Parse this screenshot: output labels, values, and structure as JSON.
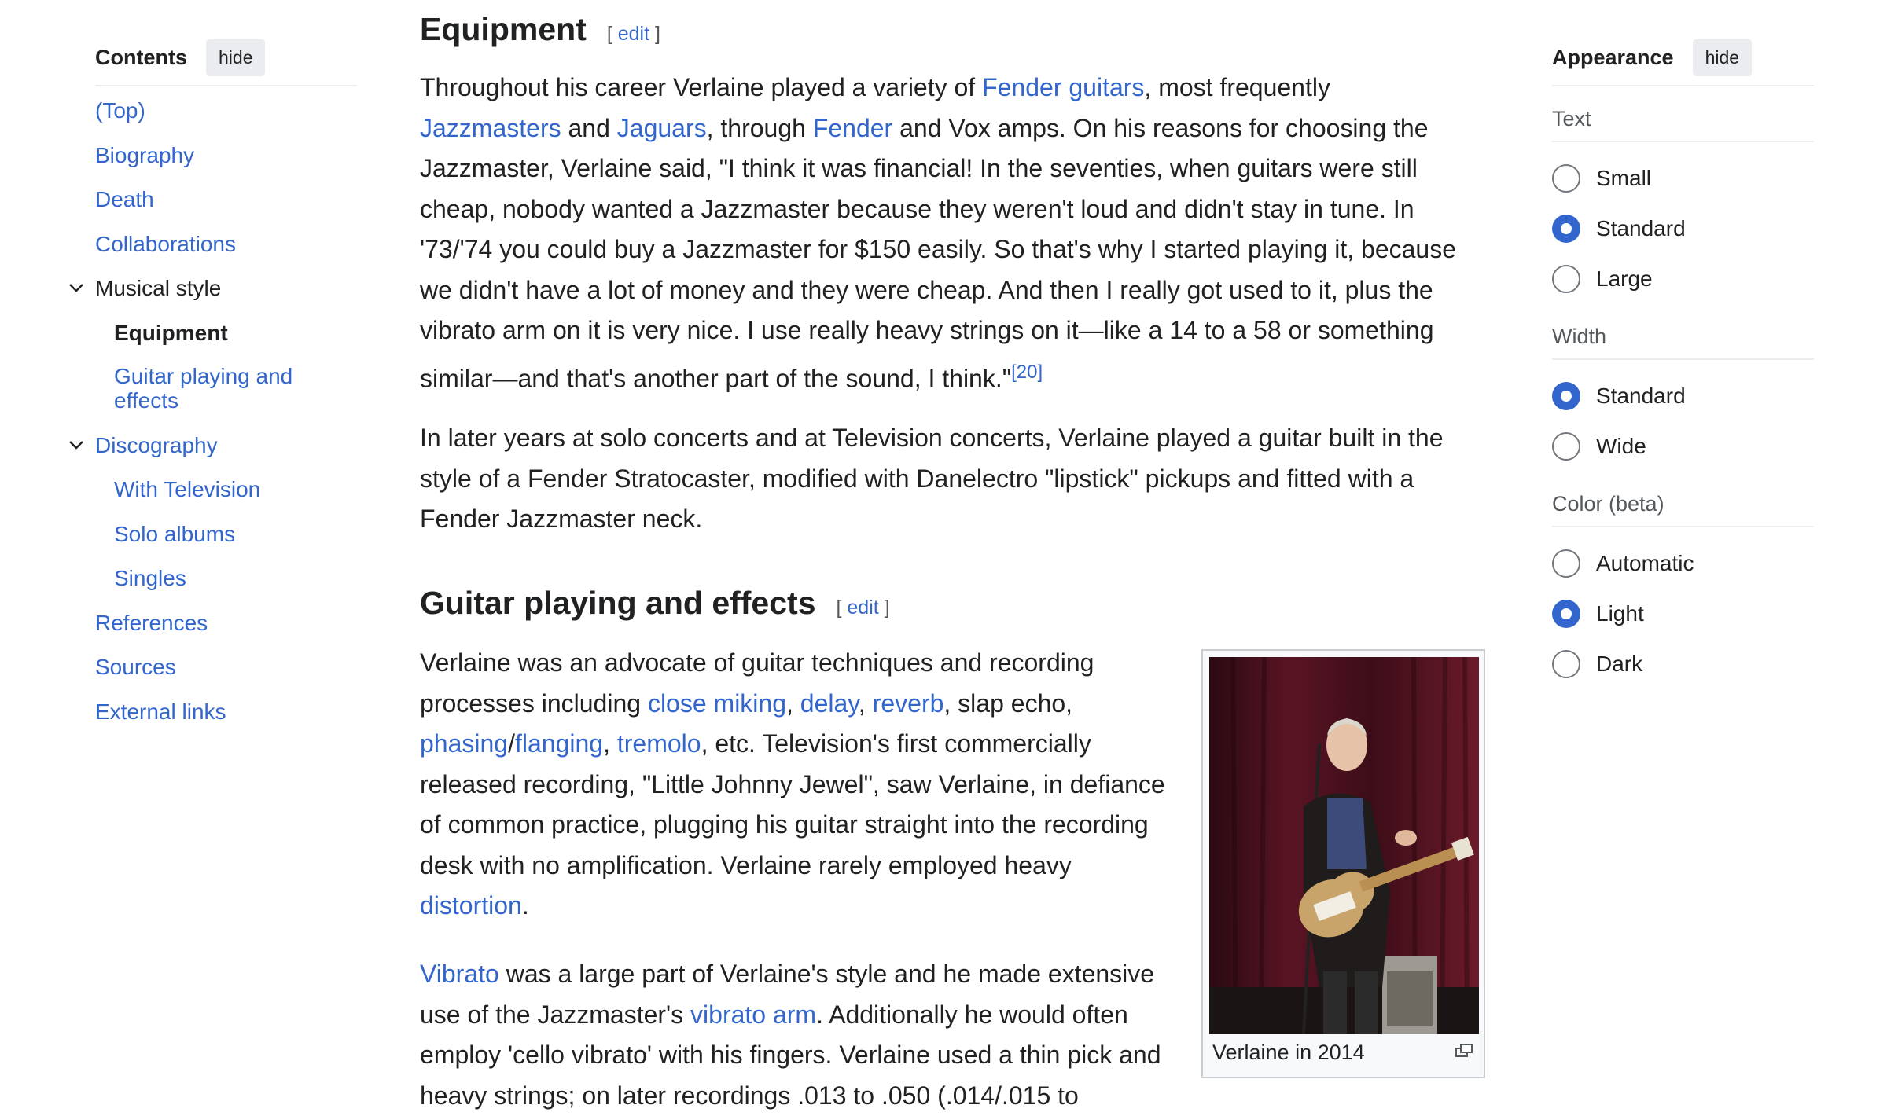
{
  "toc": {
    "title": "Contents",
    "hide_label": "hide",
    "items": [
      {
        "label": "(Top)"
      },
      {
        "label": "Biography"
      },
      {
        "label": "Death"
      },
      {
        "label": "Collaborations"
      },
      {
        "label": "Musical style"
      },
      {
        "label": "Equipment"
      },
      {
        "label": "Guitar playing and effects"
      },
      {
        "label": "Discography"
      },
      {
        "label": "With Television"
      },
      {
        "label": "Solo albums"
      },
      {
        "label": "Singles"
      },
      {
        "label": "References"
      },
      {
        "label": "Sources"
      },
      {
        "label": "External links"
      }
    ]
  },
  "sections": {
    "equipment": {
      "title": "Equipment",
      "edit": "edit",
      "p1": {
        "t1": "Throughout his career Verlaine played a variety of ",
        "l1": "Fender guitars",
        "t2": ", most frequently ",
        "l2": "Jazzmasters",
        "t3": " and ",
        "l3": "Jaguars",
        "t4": ", through ",
        "l4": "Fender",
        "t5": " and Vox amps. On his reasons for choosing the Jazzmaster, Verlaine said, \"I think it was financial! In the seventies, when guitars were still cheap, nobody wanted a Jazzmaster because they weren't loud and didn't stay in tune. In '73/'74 you could buy a Jazzmaster for $150 easily. So that's why I started playing it, because we didn't have a lot of money and they were cheap. And then I really got used to it, plus the vibrato arm on it is very nice. I use really heavy strings on it—like a 14 to a 58 or something similar—and that's another part of the sound, I think.\"",
        "ref": "[20]"
      },
      "p2": "In later years at solo concerts and at Television concerts, Verlaine played a guitar built in the style of a Fender Stratocaster, modified with Danelectro \"lipstick\" pickups and fitted with a Fender Jazzmaster neck."
    },
    "guitar": {
      "title": "Guitar playing and effects",
      "edit": "edit",
      "p1": {
        "t1": "Verlaine was an advocate of guitar techniques and recording processes including ",
        "l1": "close miking",
        "t2": ", ",
        "l2": "delay",
        "t3": ", ",
        "l3": "reverb",
        "t4": ", slap echo, ",
        "l4": "phasing",
        "t5": "/",
        "l5": "flanging",
        "t6": ", ",
        "l6": "tremolo",
        "t7": ", etc. Television's first commercially released recording, \"Little Johnny Jewel\", saw Verlaine, in defiance of common practice, plugging his guitar straight into the recording desk with no amplification. Verlaine rarely employed heavy ",
        "l7": "distortion",
        "t8": "."
      },
      "p2": {
        "l1": "Vibrato",
        "t1": " was a large part of Verlaine's style and he made extensive use of the Jazzmaster's ",
        "l2": "vibrato arm",
        "t2": ". Additionally he would often employ 'cello vibrato' with his fingers. Verlaine used a thin pick and heavy strings; on later recordings .013 to .050 (.014/.015 to"
      },
      "figure_caption": "Verlaine in 2014"
    }
  },
  "appearance": {
    "title": "Appearance",
    "hide_label": "hide",
    "groups": [
      {
        "title": "Text",
        "options": [
          "Small",
          "Standard",
          "Large"
        ],
        "selected": "Standard"
      },
      {
        "title": "Width",
        "options": [
          "Standard",
          "Wide"
        ],
        "selected": "Standard"
      },
      {
        "title": "Color (beta)",
        "options": [
          "Automatic",
          "Light",
          "Dark"
        ],
        "selected": "Light"
      }
    ]
  },
  "colors": {
    "link": "#3366cc",
    "text": "#202122",
    "accent": "#3366cc",
    "border": "#eaecf0"
  }
}
